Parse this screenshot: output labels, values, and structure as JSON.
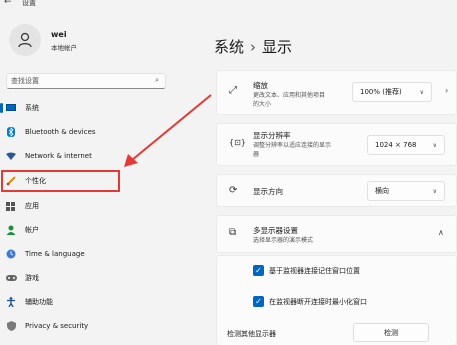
{
  "window": {
    "title": "设置",
    "back_glyph": "←"
  },
  "user": {
    "name": "wei",
    "account_type": "本地帐户"
  },
  "search": {
    "placeholder": "查找设置",
    "icon_glyph": "⌕"
  },
  "sidebar": {
    "items": [
      {
        "label": "系统",
        "icon": "monitor-icon",
        "active": true
      },
      {
        "label": "Bluetooth & devices",
        "icon": "bluetooth-icon"
      },
      {
        "label": "Network & internet",
        "icon": "wifi-icon"
      },
      {
        "label": "个性化",
        "icon": "brush-icon"
      },
      {
        "label": "应用",
        "icon": "apps-icon"
      },
      {
        "label": "帐户",
        "icon": "person-icon"
      },
      {
        "label": "Time & language",
        "icon": "globe-clock-icon"
      },
      {
        "label": "游戏",
        "icon": "gamepad-icon"
      },
      {
        "label": "辅助功能",
        "icon": "accessibility-icon"
      },
      {
        "label": "Privacy & security",
        "icon": "shield-icon"
      }
    ]
  },
  "breadcrumb": {
    "parent": "系统",
    "separator": "›",
    "current": "显示"
  },
  "settings": {
    "scale": {
      "label": "缩放",
      "desc1": "更改文本、应用和其他项目",
      "desc2": "的大小",
      "value": "100% (推荐)",
      "icon_glyph": "⤢"
    },
    "resolution": {
      "label": "显示分辨率",
      "desc1": "调整分辨率以适应连接的显示",
      "desc2": "器",
      "value": "1024 × 768",
      "icon_glyph": "{⊡}"
    },
    "orientation": {
      "label": "显示方向",
      "value": "横向",
      "icon_glyph": "⟳"
    },
    "multi": {
      "label": "多显示器设置",
      "desc": "选择显示器的演示模式",
      "icon_glyph": "⧉",
      "option1": "基于监视器连接记住窗口位置",
      "option2": "在监视器断开连接时最小化窗口",
      "detect_label": "检测其他显示器",
      "detect_button": "检测"
    }
  },
  "colors": {
    "accent": "#0067c0",
    "annotation": "#e53935"
  }
}
